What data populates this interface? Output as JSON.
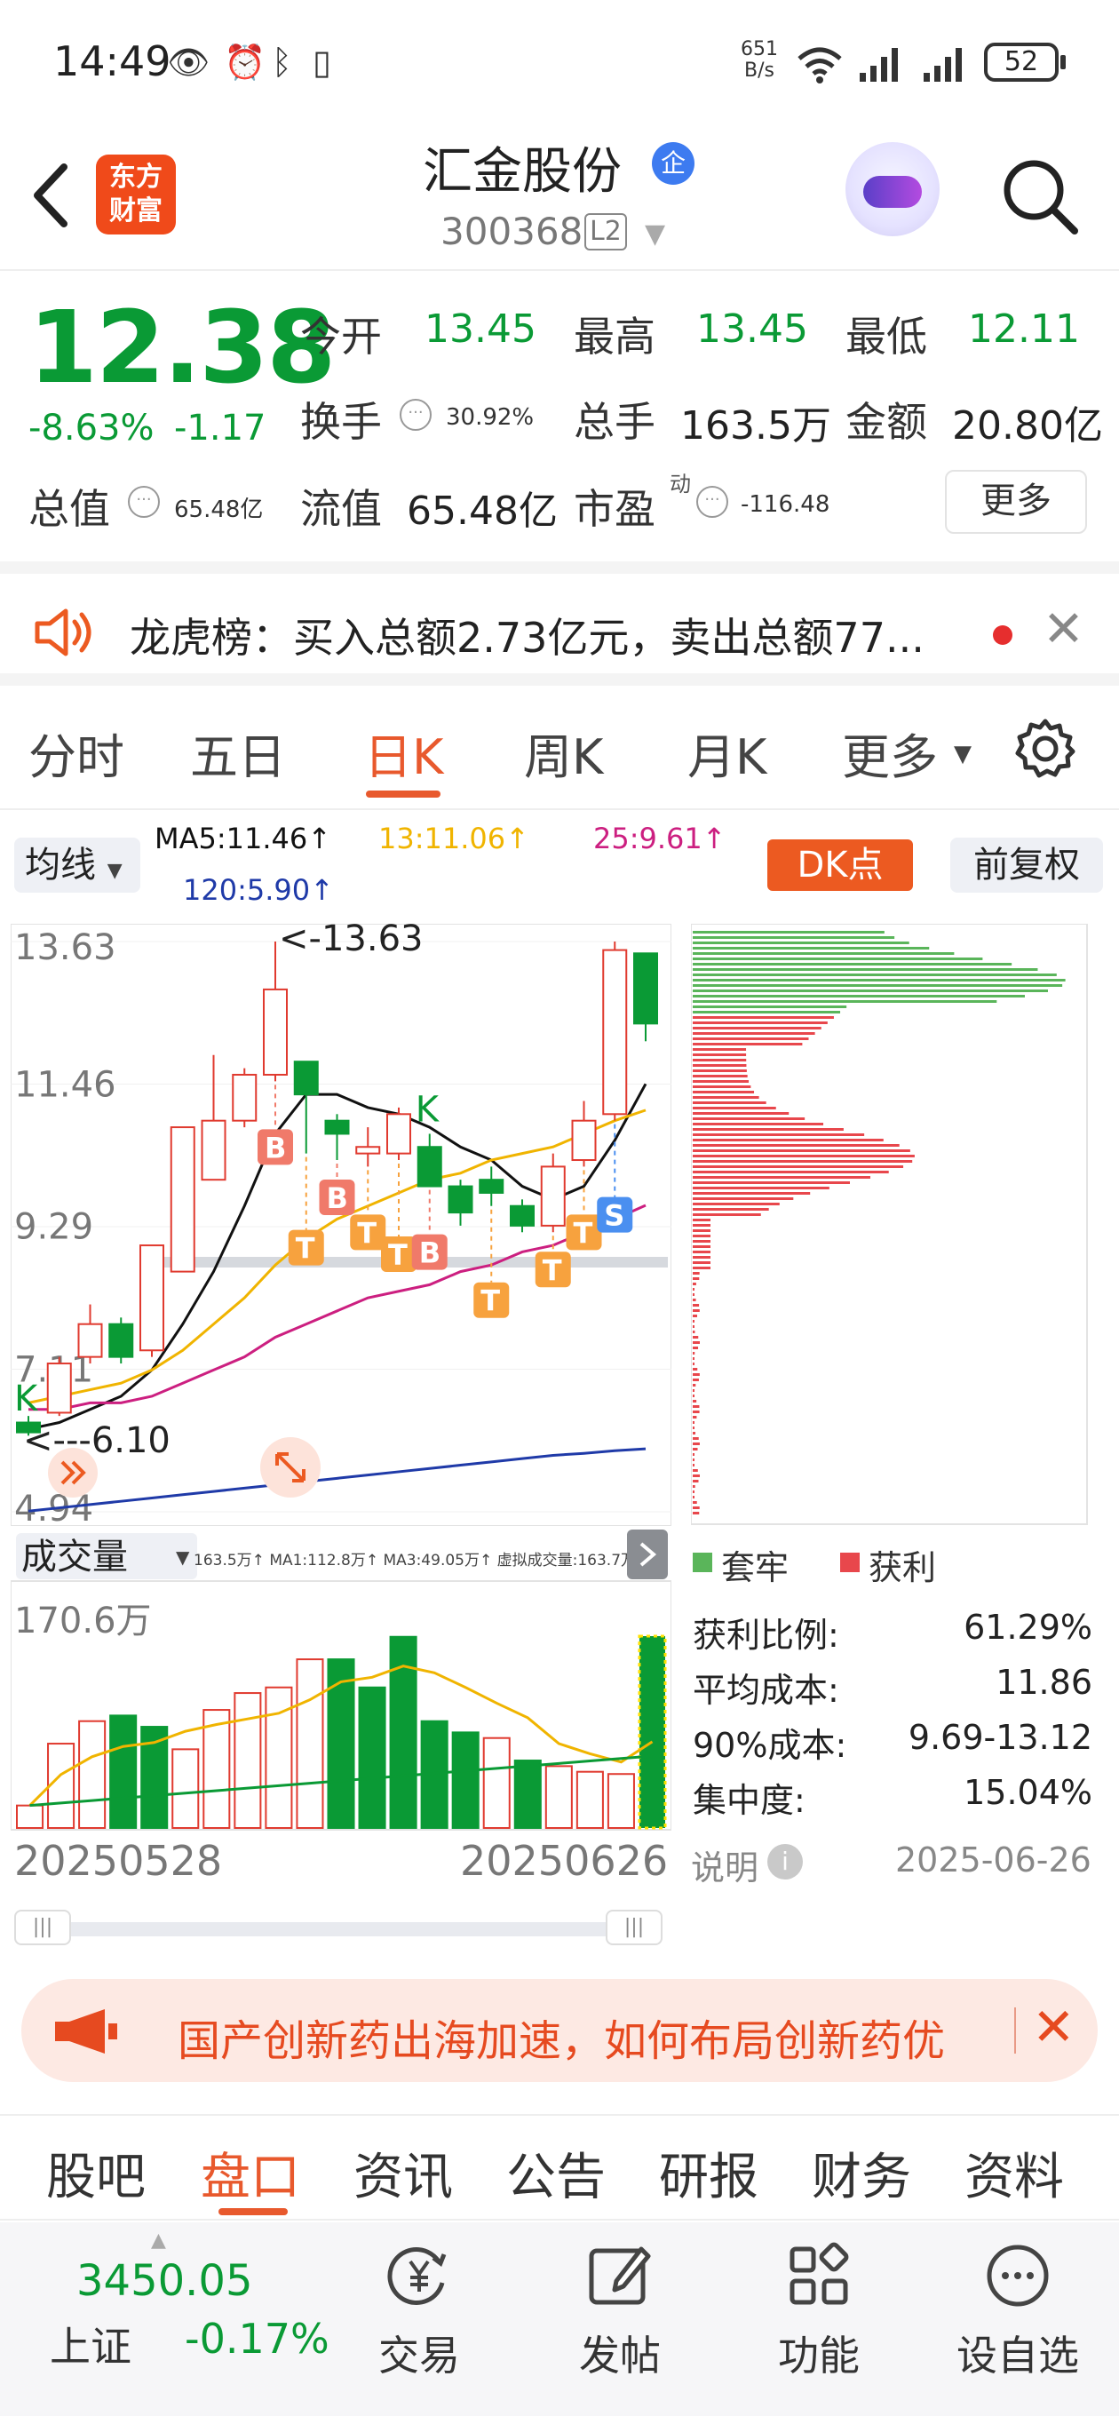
{
  "status_bar": {
    "time": "14:49",
    "net_speed_value": "651",
    "net_speed_unit": "B/s",
    "battery": "52"
  },
  "header": {
    "logo_line1": "东方",
    "logo_line2": "财富",
    "stock_name": "汇金股份",
    "ent_badge": "企",
    "stock_code": "300368",
    "level_badge": "L2"
  },
  "quote": {
    "last_price": "12.38",
    "change_pct": "-8.63%",
    "change_abs": "-1.17",
    "open_label": "今开",
    "open_value": "13.45",
    "high_label": "最高",
    "high_value": "13.45",
    "low_label": "最低",
    "low_value": "12.11",
    "turnover_label": "换手",
    "turnover_value": "30.92%",
    "volume_label": "总手",
    "volume_value": "163.5万",
    "amount_label": "金额",
    "amount_value": "20.80亿",
    "mktcap_label": "总值",
    "mktcap_value": "65.48亿",
    "float_label": "流值",
    "float_value": "65.48亿",
    "pe_label": "市盈",
    "pe_sup": "动",
    "pe_value": "-116.48",
    "more_button": "更多"
  },
  "notice": {
    "text": "龙虎榜：买入总额2.73亿元，卖出总额77..."
  },
  "period_tabs": [
    "分时",
    "五日",
    "日K",
    "周K",
    "月K",
    "更多"
  ],
  "period_active_index": 2,
  "ma_row": {
    "select_label": "均线",
    "ma5": "MA5:11.46↑",
    "ma13": "13:11.06↑",
    "ma25": "25:9.61↑",
    "ma120": "120:5.90↑",
    "dk_button": "DK点",
    "adjust_button": "前复权"
  },
  "colors": {
    "up": "#e03a2f",
    "down": "#0a9a35",
    "accent": "#e8592d",
    "ma5": "#111111",
    "ma13": "#f0b400",
    "ma25": "#cc1f80",
    "ma120": "#1f3aa8"
  },
  "chart_data": [
    {
      "type": "candlestick",
      "ylim": [
        4.94,
        13.63
      ],
      "y_ticks": [
        "13.63",
        "11.46",
        "9.29",
        "7.11",
        "4.94"
      ],
      "x_start": "20250528",
      "x_end": "20250626",
      "high_annotation": "<-13.63",
      "low_annotation": "<---6.10",
      "candles": [
        {
          "o": 6.3,
          "c": 6.15,
          "h": 6.4,
          "l": 6.1
        },
        {
          "o": 6.45,
          "c": 7.2,
          "h": 7.3,
          "l": 6.4
        },
        {
          "o": 7.3,
          "c": 7.8,
          "h": 8.1,
          "l": 7.2
        },
        {
          "o": 7.8,
          "c": 7.3,
          "h": 7.9,
          "l": 7.2
        },
        {
          "o": 7.4,
          "c": 9.0,
          "h": 9.0,
          "l": 7.3
        },
        {
          "o": 8.6,
          "c": 10.8,
          "h": 10.8,
          "l": 8.6
        },
        {
          "o": 10.0,
          "c": 10.9,
          "h": 11.9,
          "l": 10.0
        },
        {
          "o": 10.9,
          "c": 11.6,
          "h": 11.7,
          "l": 10.8
        },
        {
          "o": 11.6,
          "c": 12.9,
          "h": 13.63,
          "l": 11.5
        },
        {
          "o": 11.8,
          "c": 11.3,
          "h": 11.8,
          "l": 10.4
        },
        {
          "o": 10.9,
          "c": 10.7,
          "h": 11.0,
          "l": 10.3
        },
        {
          "o": 10.4,
          "c": 10.5,
          "h": 10.8,
          "l": 10.2
        },
        {
          "o": 10.4,
          "c": 11.0,
          "h": 11.1,
          "l": 10.3
        },
        {
          "o": 10.5,
          "c": 9.9,
          "h": 10.7,
          "l": 9.9
        },
        {
          "o": 9.9,
          "c": 9.5,
          "h": 10.0,
          "l": 9.3
        },
        {
          "o": 10.0,
          "c": 9.8,
          "h": 10.2,
          "l": 9.6
        },
        {
          "o": 9.6,
          "c": 9.3,
          "h": 9.7,
          "l": 9.2
        },
        {
          "o": 9.3,
          "c": 10.2,
          "h": 10.4,
          "l": 9.2
        },
        {
          "o": 10.3,
          "c": 10.9,
          "h": 11.2,
          "l": 10.2
        },
        {
          "o": 11.0,
          "c": 13.5,
          "h": 13.63,
          "l": 10.9
        },
        {
          "o": 13.45,
          "c": 12.38,
          "h": 13.45,
          "l": 12.11
        }
      ],
      "series": [
        {
          "name": "MA5",
          "values": [
            6.2,
            6.3,
            6.5,
            6.7,
            7.1,
            7.8,
            8.6,
            9.6,
            10.7,
            11.3,
            11.3,
            11.1,
            11.0,
            10.8,
            10.5,
            10.3,
            9.9,
            9.7,
            9.9,
            10.6,
            11.46
          ]
        },
        {
          "name": "13",
          "values": [
            6.6,
            6.7,
            6.8,
            6.9,
            7.1,
            7.4,
            7.8,
            8.2,
            8.7,
            9.1,
            9.4,
            9.6,
            9.8,
            10.0,
            10.1,
            10.3,
            10.4,
            10.5,
            10.7,
            10.9,
            11.06
          ]
        },
        {
          "name": "25",
          "values": [
            6.5,
            6.5,
            6.6,
            6.6,
            6.7,
            6.9,
            7.1,
            7.3,
            7.6,
            7.8,
            8.0,
            8.2,
            8.3,
            8.4,
            8.6,
            8.7,
            8.9,
            9.0,
            9.2,
            9.4,
            9.61
          ]
        },
        {
          "name": "120",
          "values": [
            4.95,
            5.0,
            5.05,
            5.1,
            5.15,
            5.2,
            5.25,
            5.3,
            5.35,
            5.4,
            5.45,
            5.5,
            5.55,
            5.6,
            5.65,
            5.7,
            5.75,
            5.8,
            5.83,
            5.87,
            5.9
          ]
        }
      ],
      "signals": [
        {
          "label": "K",
          "index": 0
        },
        {
          "label": "B",
          "index": 8
        },
        {
          "label": "T",
          "index": 9
        },
        {
          "label": "B",
          "index": 10
        },
        {
          "label": "T",
          "index": 11
        },
        {
          "label": "T",
          "index": 12
        },
        {
          "label": "K",
          "index": 13
        },
        {
          "label": "B",
          "index": 13
        },
        {
          "label": "T",
          "index": 15
        },
        {
          "label": "T",
          "index": 17
        },
        {
          "label": "T",
          "index": 18
        },
        {
          "label": "S",
          "index": 19
        }
      ]
    },
    {
      "type": "bar",
      "title": "成交量",
      "ylim": [
        0,
        170.6
      ],
      "y_tick": "170.6万",
      "legend": "163.5万↑ MA1:112.8万↑ MA3:49.05万↑ 虚拟成交量:163.7万",
      "values": [
        20,
        75,
        95,
        100,
        90,
        70,
        105,
        120,
        125,
        150,
        150,
        125,
        170,
        95,
        85,
        80,
        60,
        55,
        50,
        48,
        170.6
      ],
      "up": [
        true,
        true,
        true,
        false,
        false,
        true,
        true,
        true,
        true,
        true,
        false,
        false,
        false,
        false,
        false,
        true,
        false,
        true,
        true,
        true,
        false
      ]
    }
  ],
  "chip_panel": {
    "legend_trapped": "套牢",
    "legend_profit": "获利",
    "rows": [
      {
        "label": "获利比例:",
        "value": "61.29%"
      },
      {
        "label": "平均成本:",
        "value": "11.86"
      },
      {
        "label": "90%成本:",
        "value": "9.69-13.12"
      },
      {
        "label": "集中度:",
        "value": "15.04%"
      }
    ],
    "explain": "说明",
    "date": "2025-06-26"
  },
  "promo": {
    "text": "国产创新药出海加速，如何布局创新药优"
  },
  "sub_tabs": [
    "股吧",
    "盘口",
    "资讯",
    "公告",
    "研报",
    "财务",
    "资料"
  ],
  "sub_active_index": 1,
  "bottom_nav": {
    "index_value": "3450.05",
    "index_name": "上证",
    "index_change": "-0.17%",
    "items": [
      {
        "label": "交易",
        "icon": "yuan-exchange-icon"
      },
      {
        "label": "发帖",
        "icon": "edit-icon"
      },
      {
        "label": "功能",
        "icon": "grid-icon"
      },
      {
        "label": "设自选",
        "icon": "more-dots-icon"
      }
    ]
  }
}
